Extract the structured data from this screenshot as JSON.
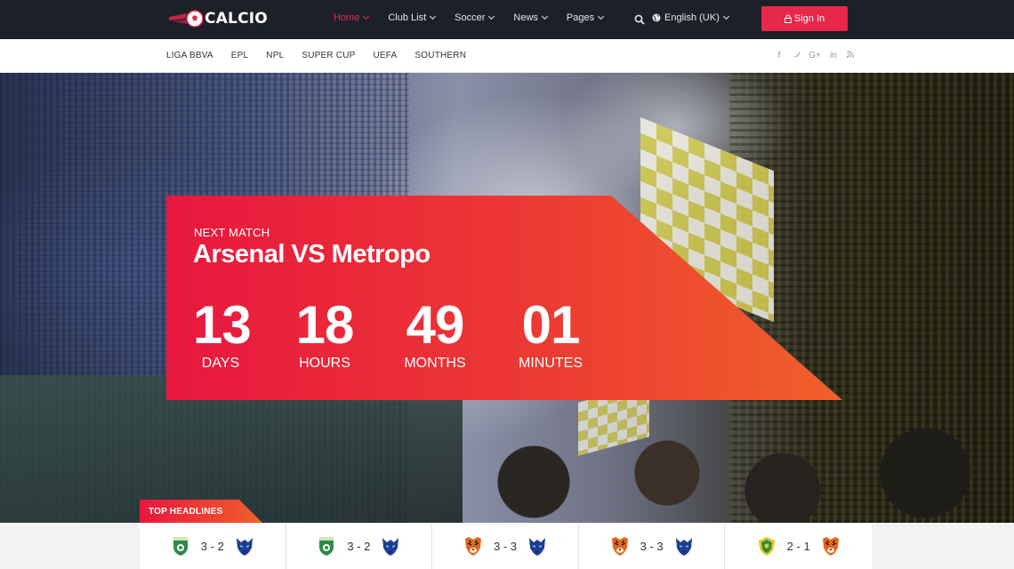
{
  "brand": {
    "name": "CALCIO"
  },
  "main_nav": [
    {
      "label": "Home",
      "active": true
    },
    {
      "label": "Club List",
      "active": false
    },
    {
      "label": "Soccer",
      "active": false
    },
    {
      "label": "News",
      "active": false
    },
    {
      "label": "Pages",
      "active": false
    }
  ],
  "language": "English (UK)",
  "signin_label": "Sign In",
  "leagues": [
    "LIGA BBVA",
    "EPL",
    "NPL",
    "SUPER CUP",
    "UEFA",
    "SOUTHERN"
  ],
  "socials": [
    "facebook-icon",
    "twitter-icon",
    "google-plus-icon",
    "linkedin-icon",
    "rss-icon"
  ],
  "hero": {
    "next_label": "NEXT MATCH",
    "match_title": "Arsenal VS Metropo",
    "countdown": [
      {
        "value": "13",
        "unit": "DAYS"
      },
      {
        "value": "18",
        "unit": "HOURS"
      },
      {
        "value": "49",
        "unit": "MONTHS"
      },
      {
        "value": "01",
        "unit": "MINUTES"
      }
    ]
  },
  "headlines_label": "TOP HEADLINES",
  "games": [
    {
      "home": "green-shield-crest",
      "score": "3 - 2",
      "away": "blue-wolf-crest"
    },
    {
      "home": "green-shield-crest",
      "score": "3 - 2",
      "away": "blue-wolf-crest"
    },
    {
      "home": "tiger-crest",
      "score": "3 - 3",
      "away": "blue-wolf-crest"
    },
    {
      "home": "tiger-crest",
      "score": "3 - 3",
      "away": "blue-wolf-crest"
    },
    {
      "home": "yellow-green-crest",
      "score": "2 - 1",
      "away": "tiger-crest"
    }
  ],
  "colors": {
    "accent": "#e8284a",
    "accent_end": "#f0602a",
    "topbar": "#1e2029"
  }
}
